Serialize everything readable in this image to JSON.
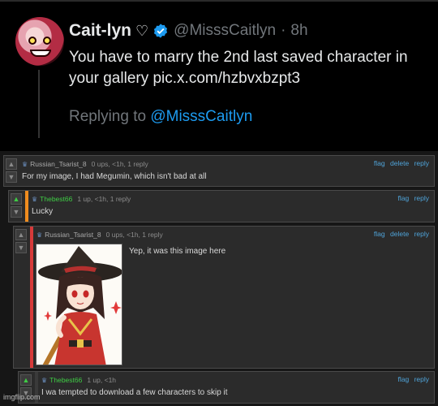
{
  "tweet": {
    "name": "Cait-lyn",
    "heart": "♡",
    "handle": "@MisssCaitlyn",
    "separator": "·",
    "time": "8h",
    "text": "You have to marry the 2nd last saved character in your gallery pic.x.com/hzbvxbzpt3",
    "replying_prefix": "Replying to",
    "replying_to": "@MisssCaitlyn",
    "accent_color": "#1d9bf0"
  },
  "comments": [
    {
      "user": "Russian_Tsarist_8",
      "meta": "0 ups, <1h, 1 reply",
      "actions": [
        "flag",
        "delete",
        "reply"
      ],
      "text": "For my image, I had Megumin, which isn't bad at all",
      "upvoted": false
    },
    {
      "user": "Thebest66",
      "meta": "1 up, <1h, 1 reply",
      "actions": [
        "flag",
        "reply"
      ],
      "text": "Lucky",
      "upvoted": true,
      "bar_color": "#f08c1e"
    },
    {
      "user": "Russian_Tsarist_8",
      "meta": "0 ups, <1h, 1 reply",
      "actions": [
        "flag",
        "delete",
        "reply"
      ],
      "text": "Yep, it was this image here",
      "upvoted": false,
      "bar_color": "#d63a3a"
    },
    {
      "user": "Thebest66",
      "meta": "1 up, <1h",
      "actions": [
        "flag",
        "reply"
      ],
      "text": "I wa tempted to download a few characters to skip it",
      "upvoted": true
    }
  ],
  "watermark": "imgflip.com",
  "icons": {
    "upvote": "up-arrow-icon",
    "downvote": "down-arrow-icon",
    "verified": "verified-badge-icon",
    "crown": "crown-icon"
  }
}
